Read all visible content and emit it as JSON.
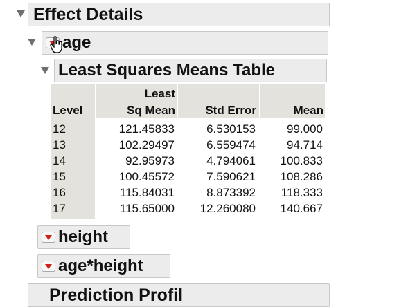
{
  "sections": {
    "effect_details": {
      "title": "Effect Details"
    },
    "age": {
      "title": "age"
    },
    "lsm_table": {
      "title": "Least Squares Means Table"
    },
    "height": {
      "title": "height"
    },
    "age_height": {
      "title": "age*height"
    },
    "prediction_profiler": {
      "title": "Prediction Profil"
    }
  },
  "table": {
    "headers": {
      "level": "Level",
      "lsmean_line1": "Least",
      "lsmean_line2": "Sq Mean",
      "stderr": "Std Error",
      "mean": "Mean"
    },
    "rows": [
      {
        "level": "12",
        "lsmean": "121.45833",
        "stderr": "6.530153",
        "mean": "99.000"
      },
      {
        "level": "13",
        "lsmean": "102.29497",
        "stderr": "6.559474",
        "mean": "94.714"
      },
      {
        "level": "14",
        "lsmean": "92.95973",
        "stderr": "4.794061",
        "mean": "100.833"
      },
      {
        "level": "15",
        "lsmean": "100.45572",
        "stderr": "7.590621",
        "mean": "108.286"
      },
      {
        "level": "16",
        "lsmean": "115.84031",
        "stderr": "8.873392",
        "mean": "118.333"
      },
      {
        "level": "17",
        "lsmean": "115.65000",
        "stderr": "12.260080",
        "mean": "140.667"
      }
    ]
  },
  "icons": {
    "disclosure": "disclosure-triangle-icon",
    "red_menu": "red-triangle-menu-icon",
    "cursor": "hand-cursor-icon"
  },
  "colors": {
    "header_bg": "#ececec",
    "table_header_bg": "#e4e2dc",
    "red_triangle": "#d0201a"
  }
}
